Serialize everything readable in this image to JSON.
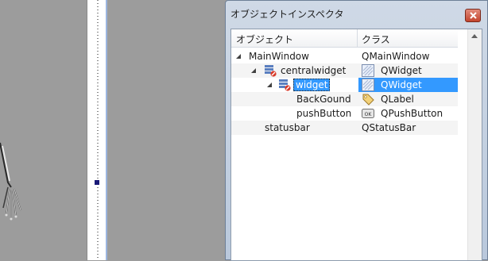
{
  "inspector": {
    "title": "オブジェクトインスペクタ",
    "columns": {
      "object": "オブジェクト",
      "class": "クラス"
    },
    "rows": [
      {
        "name": "MainWindow",
        "class": "QMainWindow",
        "icon": "none",
        "class_icon": "none",
        "expanded": true,
        "selected": false
      },
      {
        "name": "centralwidget",
        "class": "QWidget",
        "icon": "layout-broken-icon",
        "class_icon": "widget-icon",
        "expanded": true,
        "selected": false
      },
      {
        "name": "widget",
        "class": "QWidget",
        "icon": "layout-broken-icon",
        "class_icon": "widget-icon",
        "expanded": true,
        "selected": true
      },
      {
        "name": "BackGound",
        "class": "QLabel",
        "icon": "none",
        "class_icon": "label-tag-icon",
        "expanded": false,
        "selected": false
      },
      {
        "name": "pushButton",
        "class": "QPushButton",
        "icon": "none",
        "class_icon": "pushbutton-icon",
        "expanded": false,
        "selected": false
      },
      {
        "name": "statusbar",
        "class": "QStatusBar",
        "icon": "none",
        "class_icon": "none",
        "expanded": false,
        "selected": false
      }
    ]
  },
  "colors": {
    "selection": "#3399ff",
    "titlebar": "#cfd9e6",
    "close_button": "#c3442d"
  }
}
